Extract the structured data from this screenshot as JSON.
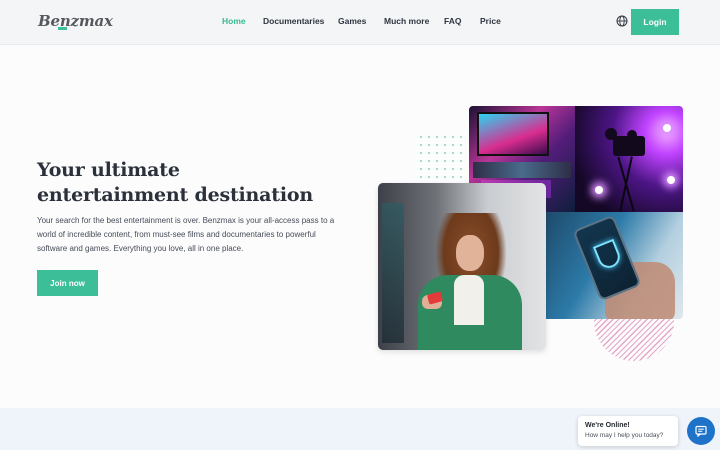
{
  "header": {
    "logo": "Benzmax",
    "nav": [
      {
        "label": "Home",
        "active": true
      },
      {
        "label": "Documentaries",
        "active": false
      },
      {
        "label": "Games",
        "active": false
      },
      {
        "label": "Much more",
        "active": false
      },
      {
        "label": "FAQ",
        "active": false
      },
      {
        "label": "Price",
        "active": false
      }
    ],
    "language_icon": "globe-icon",
    "login_label": "Login"
  },
  "hero": {
    "title": "Your ultimate entertainment destination",
    "description": "Your search for the best entertainment is over. Benzmax is your all-access pass to a world of incredible content, from must-see films and documentaries to powerful software and games. Everything you love, all in one place.",
    "cta_label": "Join now"
  },
  "chat": {
    "title": "We're Online!",
    "subtitle": "How may I help you today?",
    "icon": "chat-icon"
  },
  "colors": {
    "accent": "#3cbf98",
    "chat": "#1e73c9",
    "header_bg": "#f4f5f6"
  }
}
